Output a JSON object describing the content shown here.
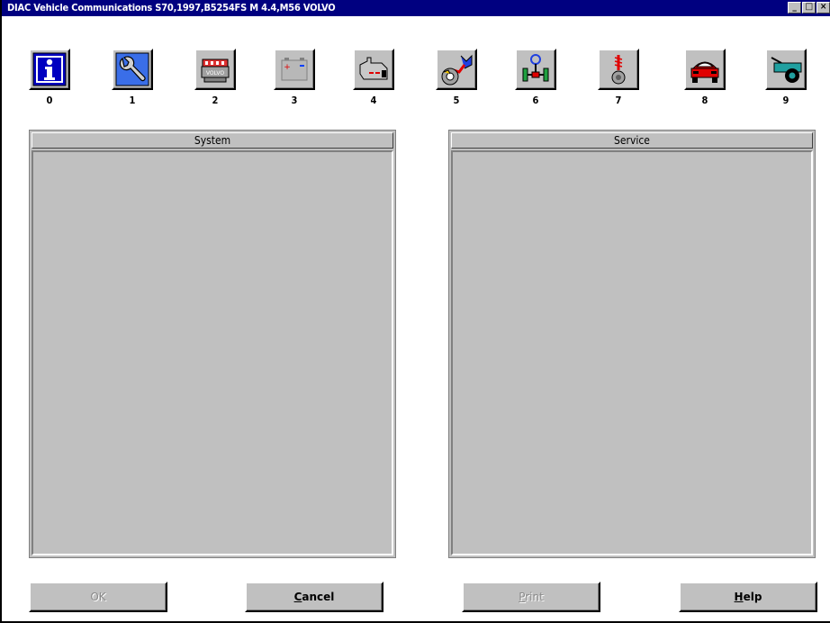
{
  "window": {
    "title": "DIAC Vehicle Communications S70,1997,B5254FS M 4.4,M56 VOLVO",
    "controls": {
      "minimize": "_",
      "maximize": "□",
      "close": "×"
    }
  },
  "toolbar": {
    "tools": [
      {
        "number": "0",
        "icon": "info-icon"
      },
      {
        "number": "1",
        "icon": "wrench-icon"
      },
      {
        "number": "2",
        "icon": "engine-volvo-icon"
      },
      {
        "number": "3",
        "icon": "battery-icon"
      },
      {
        "number": "4",
        "icon": "transmission-icon"
      },
      {
        "number": "5",
        "icon": "brake-icon"
      },
      {
        "number": "6",
        "icon": "steering-axle-icon"
      },
      {
        "number": "7",
        "icon": "suspension-wheel-icon"
      },
      {
        "number": "8",
        "icon": "car-body-icon"
      },
      {
        "number": "9",
        "icon": "towing-trailer-icon"
      }
    ]
  },
  "panels": {
    "system": {
      "header": "System"
    },
    "service": {
      "header": "Service"
    }
  },
  "buttons": {
    "ok": "OK",
    "cancel_prefix": "C",
    "cancel_rest": "ancel",
    "print_prefix": "P",
    "print_rest": "rint",
    "help_prefix": "H",
    "help_rest": "elp"
  },
  "colors": {
    "titlebar": "#000080",
    "face": "#c0c0c0",
    "disabled_text": "#8a8a8a"
  }
}
